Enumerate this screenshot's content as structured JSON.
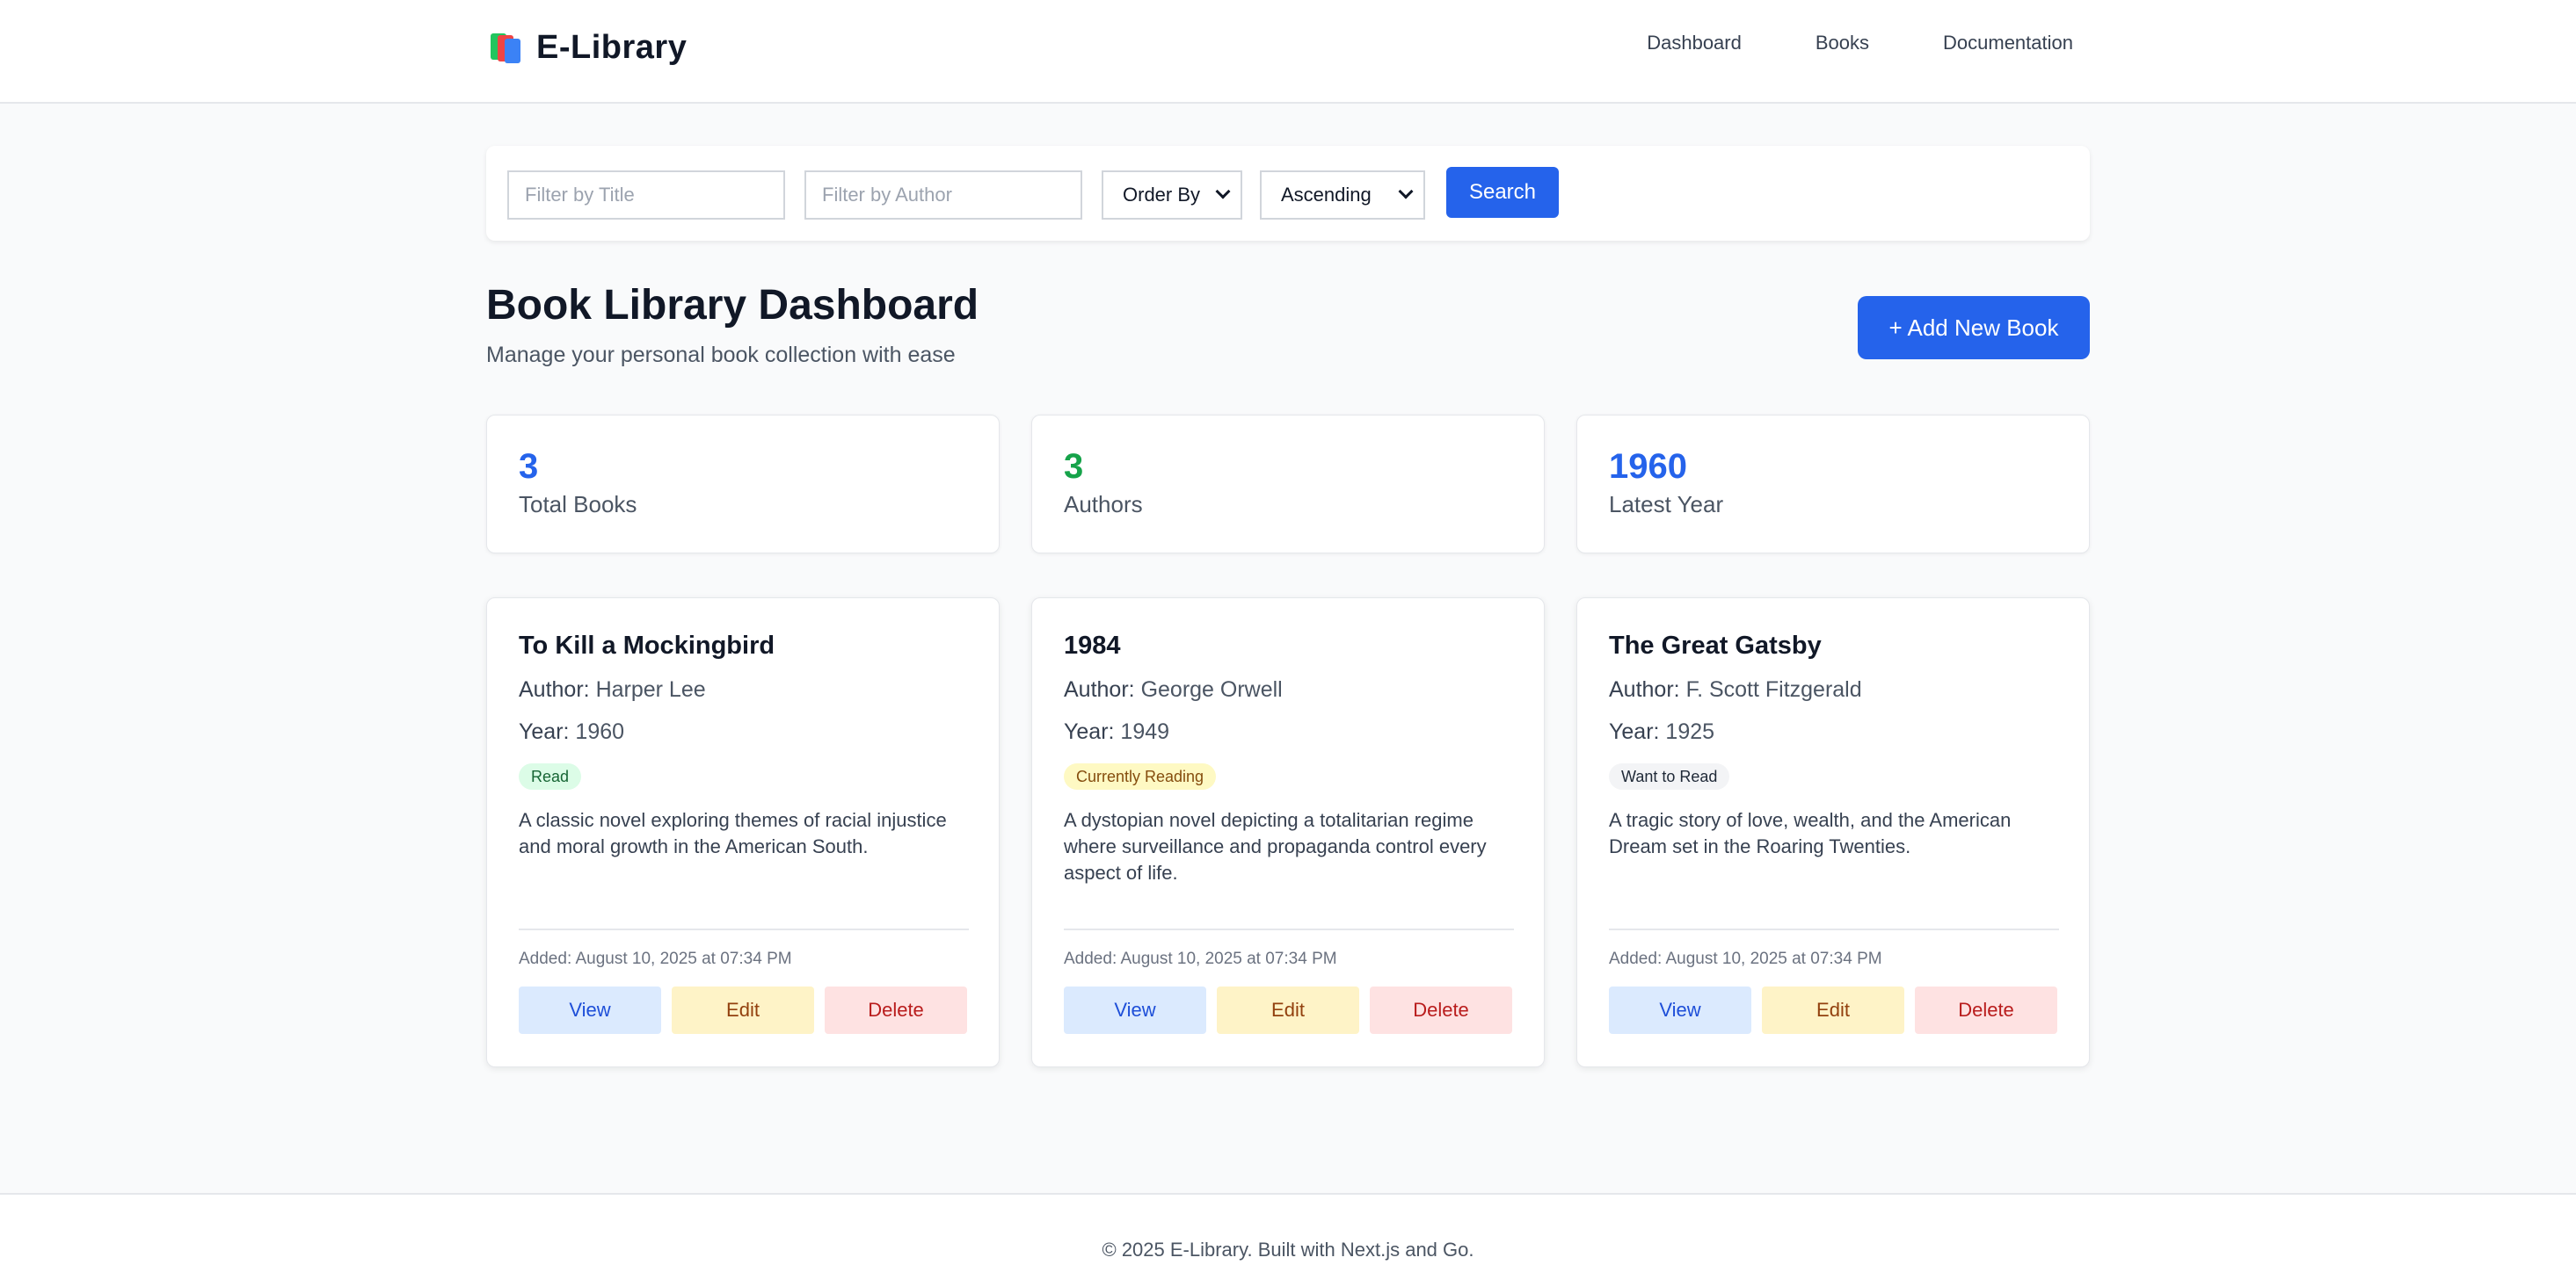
{
  "header": {
    "brand": "E-Library",
    "nav": [
      "Dashboard",
      "Books",
      "Documentation"
    ]
  },
  "filters": {
    "title_placeholder": "Filter by Title",
    "author_placeholder": "Filter by Author",
    "order_by": "Order By",
    "direction": "Ascending",
    "search_label": "Search"
  },
  "page": {
    "title": "Book Library Dashboard",
    "subtitle": "Manage your personal book collection with ease",
    "add_button": "+ Add New Book"
  },
  "stats": [
    {
      "value": "3",
      "label": "Total Books",
      "color": "#2563eb"
    },
    {
      "value": "3",
      "label": "Authors",
      "color": "#16a34a"
    },
    {
      "value": "1960",
      "label": "Latest Year",
      "color": "#2563eb"
    }
  ],
  "book_labels": {
    "author": "Author:",
    "year": "Year:",
    "view": "View",
    "edit": "Edit",
    "delete": "Delete"
  },
  "books": [
    {
      "title": "To Kill a Mockingbird",
      "author": "Harper Lee",
      "year": "1960",
      "status": "Read",
      "status_bg": "#dcfce7",
      "status_color": "#166534",
      "description": "A classic novel exploring themes of racial injustice and moral growth in the American South.",
      "added": "Added: August 10, 2025 at 07:34 PM"
    },
    {
      "title": "1984",
      "author": "George Orwell",
      "year": "1949",
      "status": "Currently Reading",
      "status_bg": "#fef9c3",
      "status_color": "#854d0e",
      "description": "A dystopian novel depicting a totalitarian regime where surveillance and propaganda control every aspect of life.",
      "added": "Added: August 10, 2025 at 07:34 PM"
    },
    {
      "title": "The Great Gatsby",
      "author": "F. Scott Fitzgerald",
      "year": "1925",
      "status": "Want to Read",
      "status_bg": "#f3f4f6",
      "status_color": "#1f2937",
      "description": "A tragic story of love, wealth, and the American Dream set in the Roaring Twenties.",
      "added": "Added: August 10, 2025 at 07:34 PM"
    }
  ],
  "footer": {
    "text": "© 2025 E-Library. Built with Next.js and Go."
  }
}
